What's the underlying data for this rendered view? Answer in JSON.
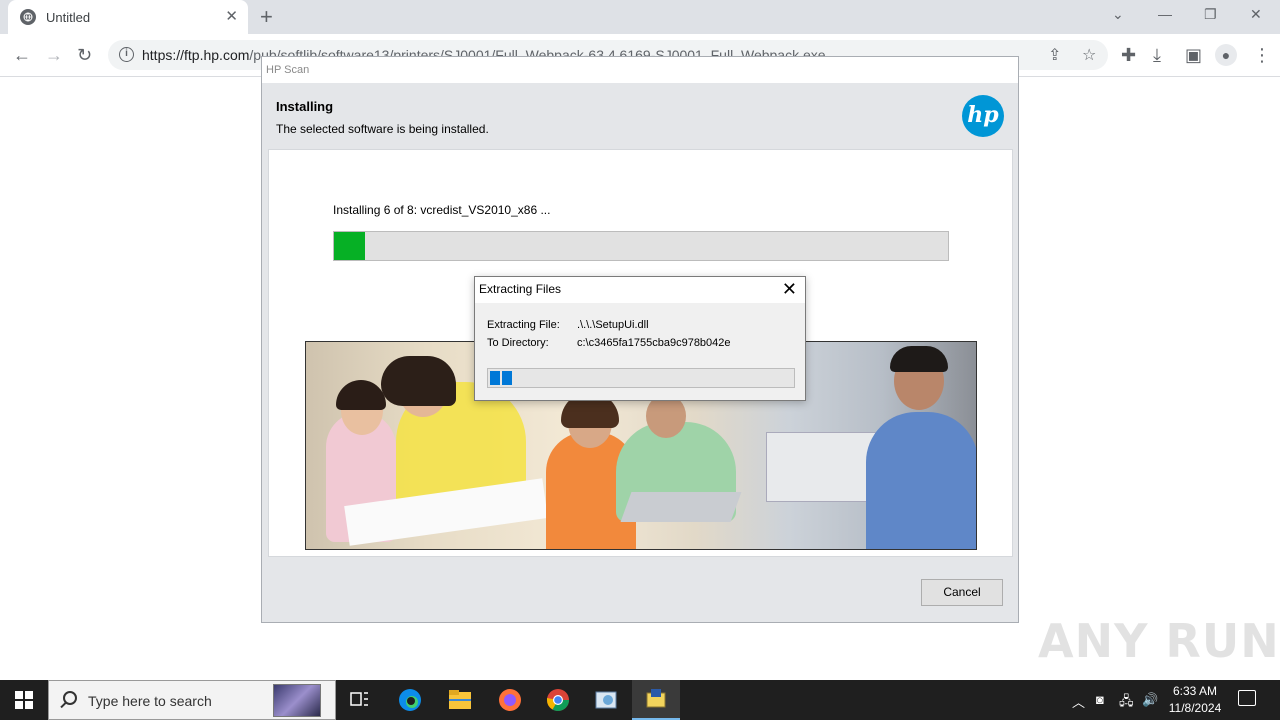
{
  "browser": {
    "tab_title": "Untitled",
    "url_host": "https://ftp.hp.com",
    "url_path": "/pub/softlib/software13/printers/SJ0001/Full_Webpack-63.4.6169-SJ0001_Full_Webpack.exe"
  },
  "hp_window": {
    "title": "HP Scan",
    "heading": "Installing",
    "subtext": "The selected software is being installed.",
    "logo_text": "hp",
    "status": "Installing 6 of 8: vcredist_VS2010_x86 ...",
    "progress": 0.05,
    "cancel_label": "Cancel",
    "accent_color": "#06b025"
  },
  "extract_dialog": {
    "title": "Extracting Files",
    "file_label": "Extracting File:",
    "file_value": ".\\.\\.\\SetupUi.dll",
    "dir_label": "To Directory:",
    "dir_value": "c:\\c3465fa1755cba9c978b042e",
    "progress_blocks": 2,
    "accent_color": "#0078d7"
  },
  "watermark": "ANY RUN",
  "taskbar": {
    "search_placeholder": "Type here to search",
    "time": "6:33 AM",
    "date": "11/8/2024"
  }
}
